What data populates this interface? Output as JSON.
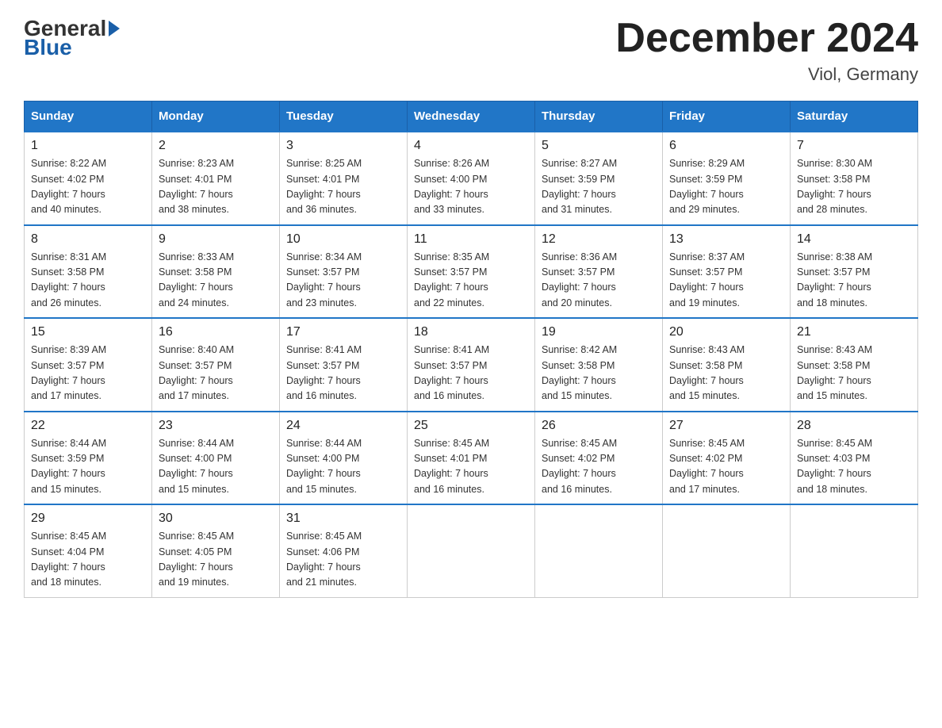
{
  "header": {
    "logo": {
      "general": "General",
      "blue": "Blue"
    },
    "title": "December 2024",
    "location": "Viol, Germany"
  },
  "days_of_week": [
    "Sunday",
    "Monday",
    "Tuesday",
    "Wednesday",
    "Thursday",
    "Friday",
    "Saturday"
  ],
  "weeks": [
    [
      {
        "day": 1,
        "sunrise": "8:22 AM",
        "sunset": "4:02 PM",
        "daylight": "7 hours and 40 minutes."
      },
      {
        "day": 2,
        "sunrise": "8:23 AM",
        "sunset": "4:01 PM",
        "daylight": "7 hours and 38 minutes."
      },
      {
        "day": 3,
        "sunrise": "8:25 AM",
        "sunset": "4:01 PM",
        "daylight": "7 hours and 36 minutes."
      },
      {
        "day": 4,
        "sunrise": "8:26 AM",
        "sunset": "4:00 PM",
        "daylight": "7 hours and 33 minutes."
      },
      {
        "day": 5,
        "sunrise": "8:27 AM",
        "sunset": "3:59 PM",
        "daylight": "7 hours and 31 minutes."
      },
      {
        "day": 6,
        "sunrise": "8:29 AM",
        "sunset": "3:59 PM",
        "daylight": "7 hours and 29 minutes."
      },
      {
        "day": 7,
        "sunrise": "8:30 AM",
        "sunset": "3:58 PM",
        "daylight": "7 hours and 28 minutes."
      }
    ],
    [
      {
        "day": 8,
        "sunrise": "8:31 AM",
        "sunset": "3:58 PM",
        "daylight": "7 hours and 26 minutes."
      },
      {
        "day": 9,
        "sunrise": "8:33 AM",
        "sunset": "3:58 PM",
        "daylight": "7 hours and 24 minutes."
      },
      {
        "day": 10,
        "sunrise": "8:34 AM",
        "sunset": "3:57 PM",
        "daylight": "7 hours and 23 minutes."
      },
      {
        "day": 11,
        "sunrise": "8:35 AM",
        "sunset": "3:57 PM",
        "daylight": "7 hours and 22 minutes."
      },
      {
        "day": 12,
        "sunrise": "8:36 AM",
        "sunset": "3:57 PM",
        "daylight": "7 hours and 20 minutes."
      },
      {
        "day": 13,
        "sunrise": "8:37 AM",
        "sunset": "3:57 PM",
        "daylight": "7 hours and 19 minutes."
      },
      {
        "day": 14,
        "sunrise": "8:38 AM",
        "sunset": "3:57 PM",
        "daylight": "7 hours and 18 minutes."
      }
    ],
    [
      {
        "day": 15,
        "sunrise": "8:39 AM",
        "sunset": "3:57 PM",
        "daylight": "7 hours and 17 minutes."
      },
      {
        "day": 16,
        "sunrise": "8:40 AM",
        "sunset": "3:57 PM",
        "daylight": "7 hours and 17 minutes."
      },
      {
        "day": 17,
        "sunrise": "8:41 AM",
        "sunset": "3:57 PM",
        "daylight": "7 hours and 16 minutes."
      },
      {
        "day": 18,
        "sunrise": "8:41 AM",
        "sunset": "3:57 PM",
        "daylight": "7 hours and 16 minutes."
      },
      {
        "day": 19,
        "sunrise": "8:42 AM",
        "sunset": "3:58 PM",
        "daylight": "7 hours and 15 minutes."
      },
      {
        "day": 20,
        "sunrise": "8:43 AM",
        "sunset": "3:58 PM",
        "daylight": "7 hours and 15 minutes."
      },
      {
        "day": 21,
        "sunrise": "8:43 AM",
        "sunset": "3:58 PM",
        "daylight": "7 hours and 15 minutes."
      }
    ],
    [
      {
        "day": 22,
        "sunrise": "8:44 AM",
        "sunset": "3:59 PM",
        "daylight": "7 hours and 15 minutes."
      },
      {
        "day": 23,
        "sunrise": "8:44 AM",
        "sunset": "4:00 PM",
        "daylight": "7 hours and 15 minutes."
      },
      {
        "day": 24,
        "sunrise": "8:44 AM",
        "sunset": "4:00 PM",
        "daylight": "7 hours and 15 minutes."
      },
      {
        "day": 25,
        "sunrise": "8:45 AM",
        "sunset": "4:01 PM",
        "daylight": "7 hours and 16 minutes."
      },
      {
        "day": 26,
        "sunrise": "8:45 AM",
        "sunset": "4:02 PM",
        "daylight": "7 hours and 16 minutes."
      },
      {
        "day": 27,
        "sunrise": "8:45 AM",
        "sunset": "4:02 PM",
        "daylight": "7 hours and 17 minutes."
      },
      {
        "day": 28,
        "sunrise": "8:45 AM",
        "sunset": "4:03 PM",
        "daylight": "7 hours and 18 minutes."
      }
    ],
    [
      {
        "day": 29,
        "sunrise": "8:45 AM",
        "sunset": "4:04 PM",
        "daylight": "7 hours and 18 minutes."
      },
      {
        "day": 30,
        "sunrise": "8:45 AM",
        "sunset": "4:05 PM",
        "daylight": "7 hours and 19 minutes."
      },
      {
        "day": 31,
        "sunrise": "8:45 AM",
        "sunset": "4:06 PM",
        "daylight": "7 hours and 21 minutes."
      },
      null,
      null,
      null,
      null
    ]
  ]
}
